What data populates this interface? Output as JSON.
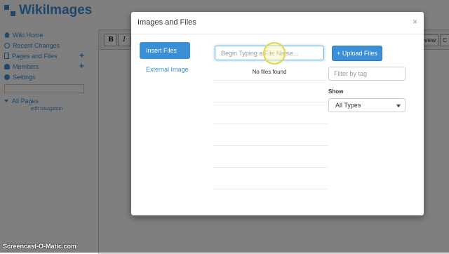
{
  "app": {
    "logo_text": "WikiImages",
    "sidebar": {
      "items": [
        {
          "label": "Wiki Home",
          "icon": "home-icon"
        },
        {
          "label": "Recent Changes",
          "icon": "clock-icon"
        },
        {
          "label": "Pages and Files",
          "icon": "files-icon"
        },
        {
          "label": "Members",
          "icon": "user-icon"
        },
        {
          "label": "Settings",
          "icon": "gear-icon"
        }
      ],
      "all_pages_label": "All Pages",
      "edit_nav_label": "edit navigation"
    },
    "editor": {
      "toolbar_buttons": [
        "B",
        "I"
      ],
      "toolbar_right": [
        "Preview",
        "C"
      ]
    }
  },
  "modal": {
    "title": "Images and Files",
    "close_glyph": "×",
    "tabs": [
      {
        "label": "Insert Files",
        "active": true
      },
      {
        "label": "External Image",
        "active": false
      }
    ],
    "search": {
      "placeholder": "Begin Typing a File Name..."
    },
    "empty_message": "No files found",
    "upload_label": "+ Upload Files",
    "tag_filter": {
      "placeholder": "Filter by tag"
    },
    "show_label": "Show",
    "type_select": {
      "value": "All Types"
    }
  },
  "watermark": "Screencast-O-Matic.com",
  "colors": {
    "accent": "#3a8fd6",
    "overlay": "rgba(0,0,0,0.5)"
  }
}
